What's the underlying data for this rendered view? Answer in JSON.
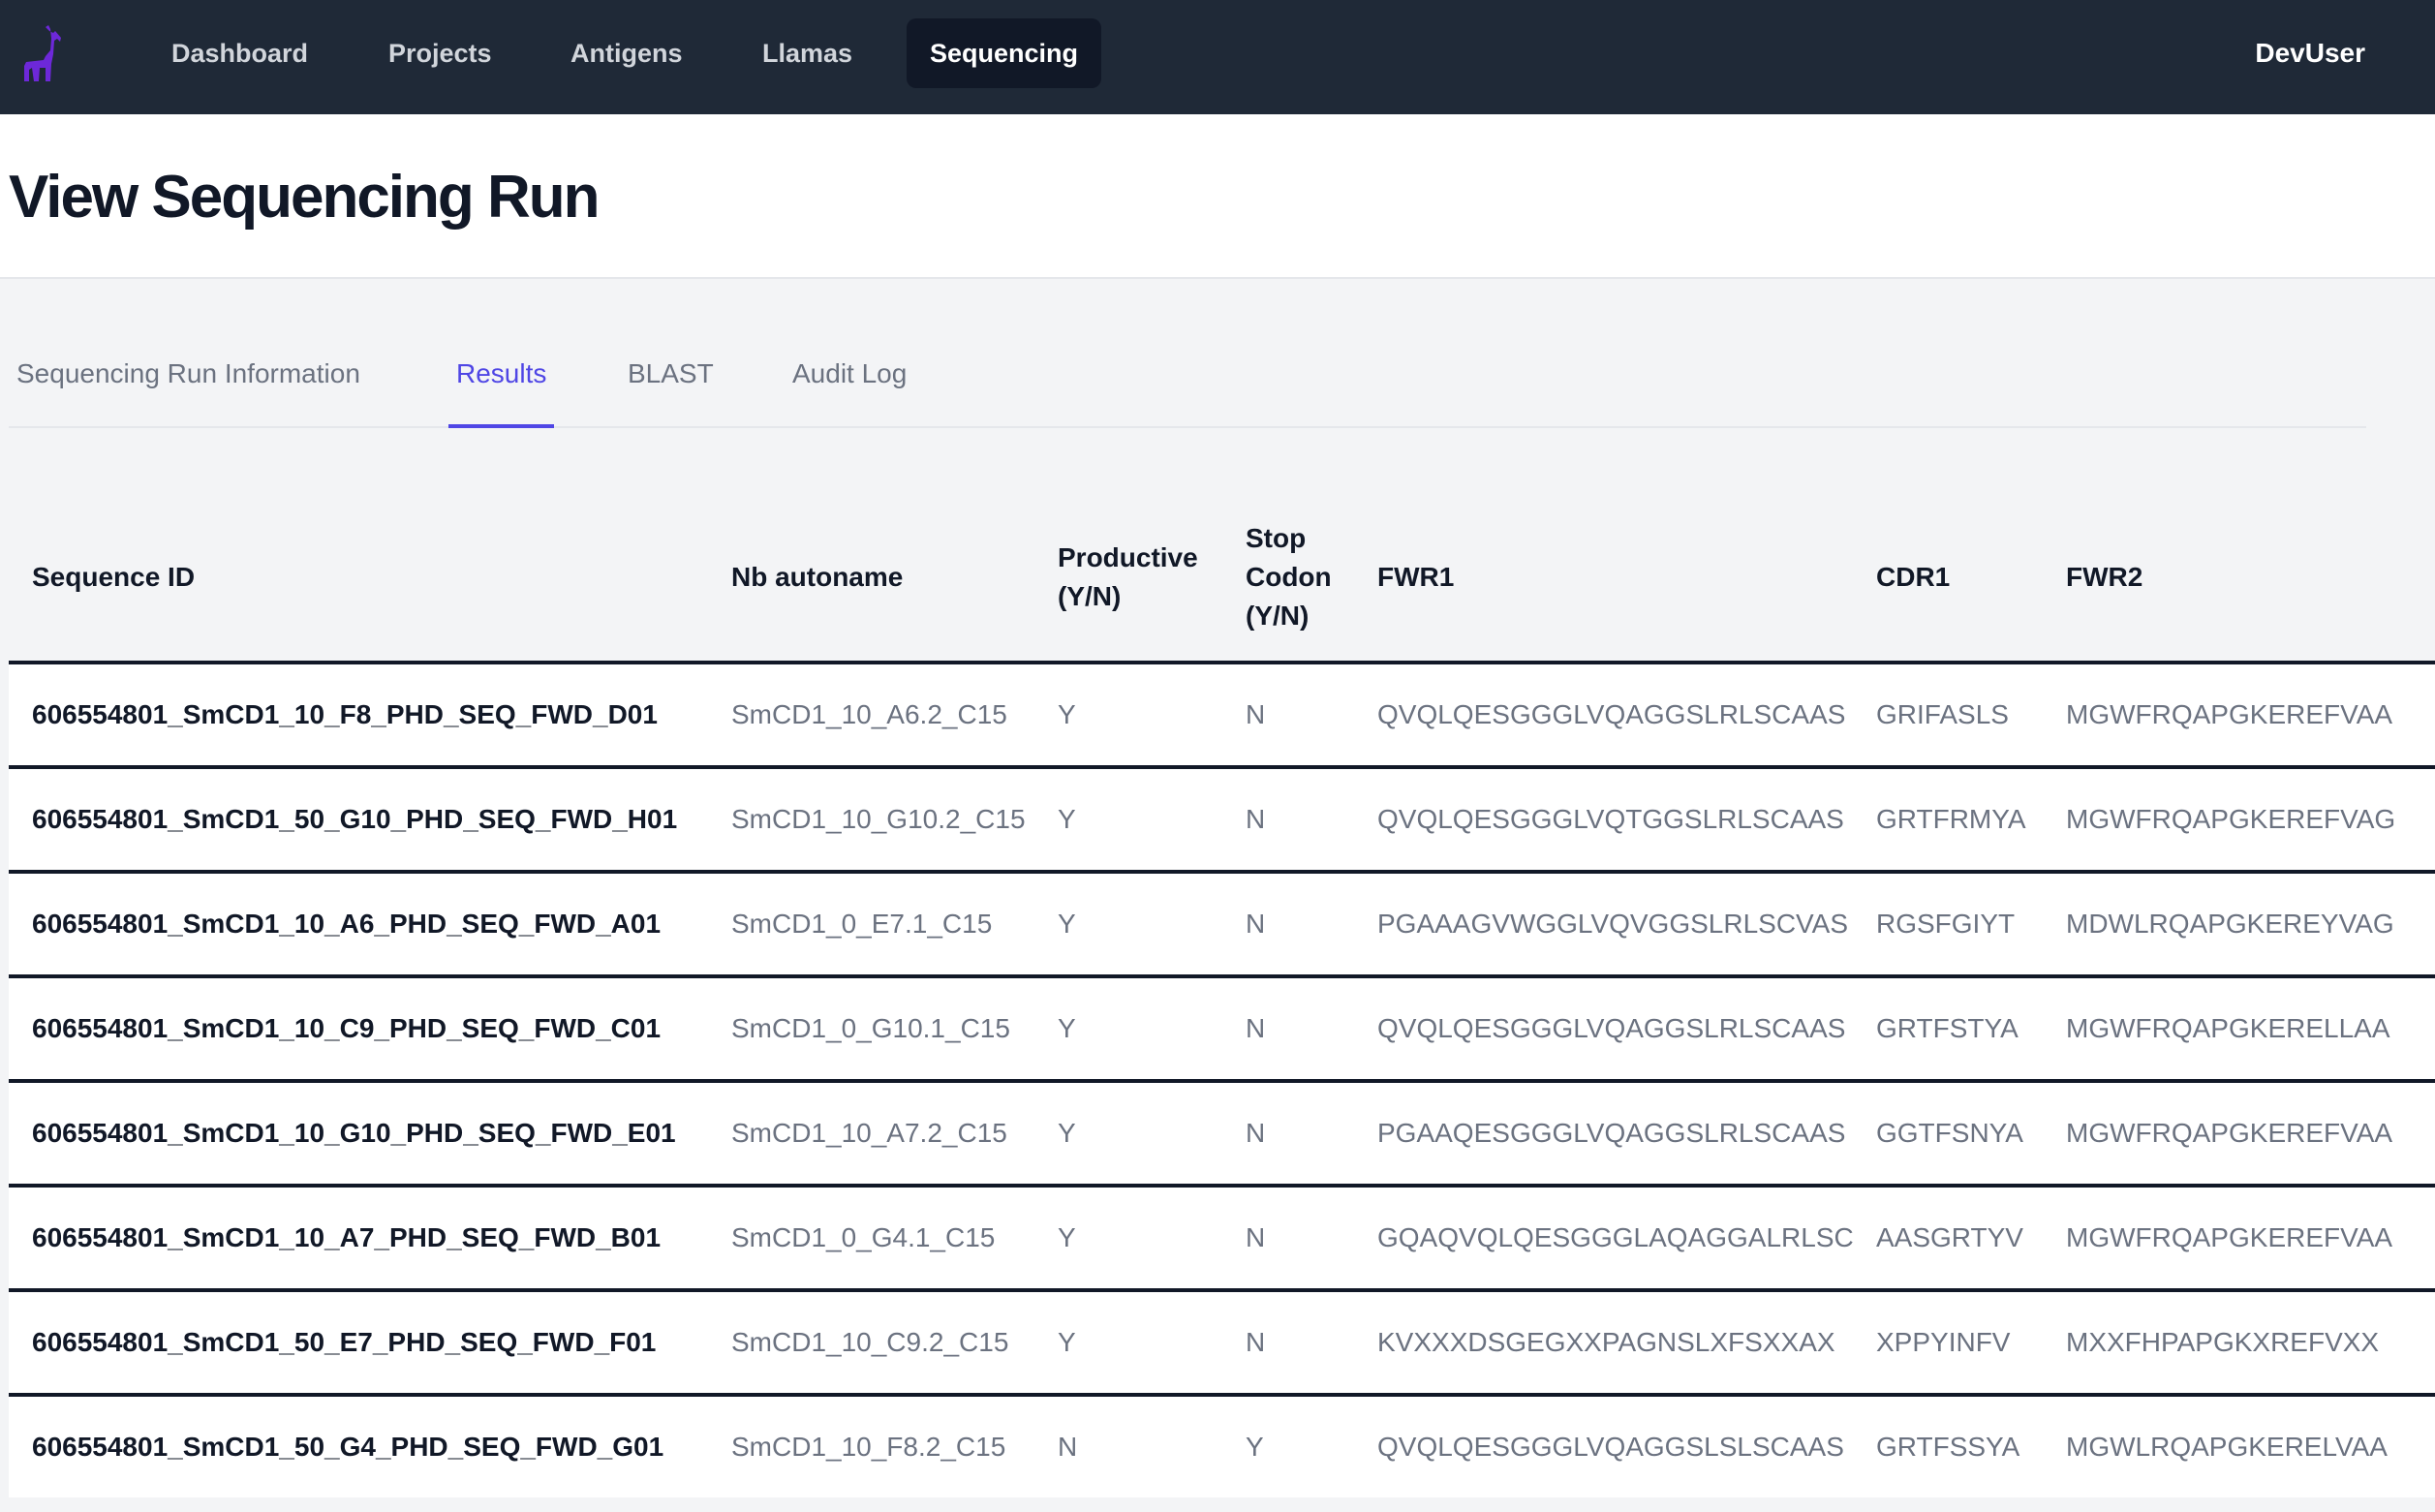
{
  "nav": {
    "logo_icon": "llama-icon",
    "logo_color": "#6d28d9",
    "items": [
      {
        "label": "Dashboard"
      },
      {
        "label": "Projects"
      },
      {
        "label": "Antigens"
      },
      {
        "label": "Llamas"
      },
      {
        "label": "Sequencing",
        "active": true
      }
    ],
    "user": "DevUser"
  },
  "page": {
    "title": "View Sequencing Run"
  },
  "tabs": [
    {
      "label": "Sequencing Run Information"
    },
    {
      "label": "Results",
      "active": true
    },
    {
      "label": "BLAST"
    },
    {
      "label": "Audit Log"
    }
  ],
  "accent_color": "#4f46e5",
  "table": {
    "headers": {
      "sequence_id": "Sequence ID",
      "nb_autoname": "Nb autoname",
      "productive_line1": "Productive",
      "productive_line2": "(Y/N)",
      "stop_line1": "Stop",
      "stop_line2": "Codon",
      "stop_line3": "(Y/N)",
      "fwr1": "FWR1",
      "cdr1": "CDR1",
      "fwr2": "FWR2"
    },
    "rows": [
      {
        "sequence_id": "606554801_SmCD1_10_F8_PHD_SEQ_FWD_D01",
        "nb_autoname": "SmCD1_10_A6.2_C15",
        "productive": "Y",
        "stop_codon": "N",
        "fwr1": "QVQLQESGGGLVQAGGSLRLSCAAS",
        "cdr1": "GRIFASLS",
        "fwr2": "MGWFRQAPGKEREFVAA"
      },
      {
        "sequence_id": "606554801_SmCD1_50_G10_PHD_SEQ_FWD_H01",
        "nb_autoname": "SmCD1_10_G10.2_C15",
        "productive": "Y",
        "stop_codon": "N",
        "fwr1": "QVQLQESGGGLVQTGGSLRLSCAAS",
        "cdr1": "GRTFRMYA",
        "fwr2": "MGWFRQAPGKEREFVAG"
      },
      {
        "sequence_id": "606554801_SmCD1_10_A6_PHD_SEQ_FWD_A01",
        "nb_autoname": "SmCD1_0_E7.1_C15",
        "productive": "Y",
        "stop_codon": "N",
        "fwr1": "PGAAAGVWGGLVQVGGSLRLSCVAS",
        "cdr1": "RGSFGIYT",
        "fwr2": "MDWLRQAPGKEREYVAG"
      },
      {
        "sequence_id": "606554801_SmCD1_10_C9_PHD_SEQ_FWD_C01",
        "nb_autoname": "SmCD1_0_G10.1_C15",
        "productive": "Y",
        "stop_codon": "N",
        "fwr1": "QVQLQESGGGLVQAGGSLRLSCAAS",
        "cdr1": "GRTFSTYA",
        "fwr2": "MGWFRQAPGKERELLAA"
      },
      {
        "sequence_id": "606554801_SmCD1_10_G10_PHD_SEQ_FWD_E01",
        "nb_autoname": "SmCD1_10_A7.2_C15",
        "productive": "Y",
        "stop_codon": "N",
        "fwr1": "PGAAQESGGGLVQAGGSLRLSCAAS",
        "cdr1": "GGTFSNYA",
        "fwr2": "MGWFRQAPGKEREFVAA"
      },
      {
        "sequence_id": "606554801_SmCD1_10_A7_PHD_SEQ_FWD_B01",
        "nb_autoname": "SmCD1_0_G4.1_C15",
        "productive": "Y",
        "stop_codon": "N",
        "fwr1": "GQAQVQLQESGGGLAQAGGALRLSC",
        "cdr1": "AASGRTYV",
        "fwr2": "MGWFRQAPGKEREFVAA"
      },
      {
        "sequence_id": "606554801_SmCD1_50_E7_PHD_SEQ_FWD_F01",
        "nb_autoname": "SmCD1_10_C9.2_C15",
        "productive": "Y",
        "stop_codon": "N",
        "fwr1": "KVXXXDSGEGXXPAGNSLXFSXXAX",
        "cdr1": "XPPYINFV",
        "fwr2": "MXXFHPAPGKXREFVXX"
      },
      {
        "sequence_id": "606554801_SmCD1_50_G4_PHD_SEQ_FWD_G01",
        "nb_autoname": "SmCD1_10_F8.2_C15",
        "productive": "N",
        "stop_codon": "Y",
        "fwr1": "QVQLQESGGGLVQAGGSLSLSCAAS",
        "cdr1": "GRTFSSYA",
        "fwr2": "MGWLRQAPGKERELVAA"
      }
    ]
  }
}
